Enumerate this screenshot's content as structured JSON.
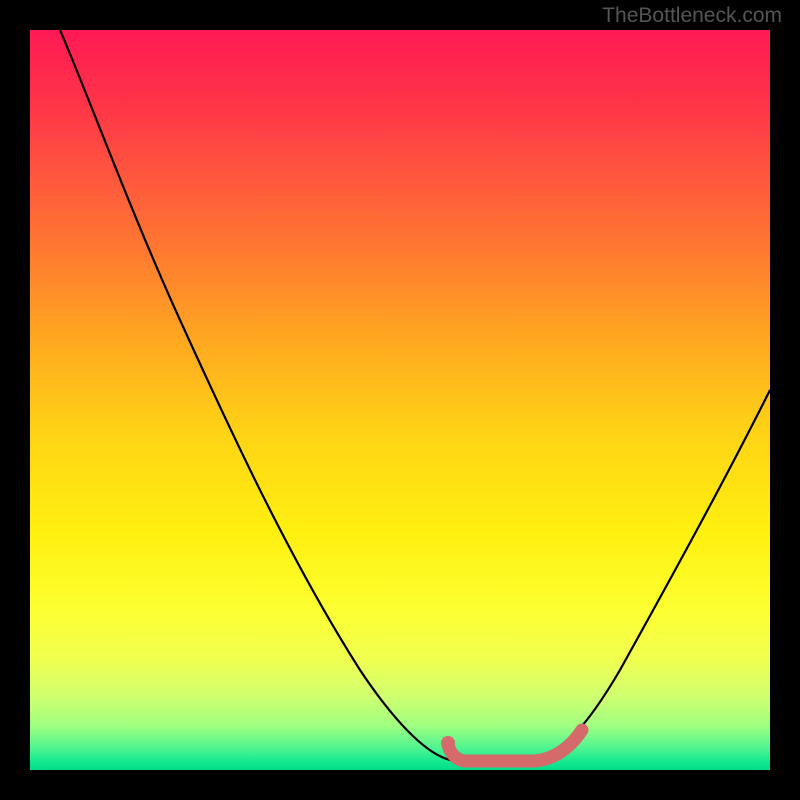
{
  "watermark": "TheBottleneck.com",
  "chart_data": {
    "type": "line",
    "title": "",
    "xlabel": "",
    "ylabel": "",
    "xlim": [
      0,
      100
    ],
    "ylim": [
      0,
      100
    ],
    "series": [
      {
        "name": "bottleneck-curve",
        "x": [
          4,
          10,
          18,
          26,
          34,
          42,
          50,
          56,
          60,
          64,
          68,
          72,
          76,
          82,
          88,
          94,
          100
        ],
        "y": [
          100,
          90,
          78,
          64,
          50,
          36,
          22,
          10,
          4,
          1,
          1,
          1,
          4,
          12,
          24,
          38,
          54
        ]
      }
    ],
    "highlight_region": {
      "name": "optimal-flat-region",
      "x_start": 58,
      "x_end": 75,
      "color": "#d46a6a"
    },
    "gradient_stops": [
      {
        "pct": 0,
        "color": "#ff1a55"
      },
      {
        "pct": 50,
        "color": "#ffd515"
      },
      {
        "pct": 85,
        "color": "#f0ff50"
      },
      {
        "pct": 100,
        "color": "#00dd88"
      }
    ]
  }
}
